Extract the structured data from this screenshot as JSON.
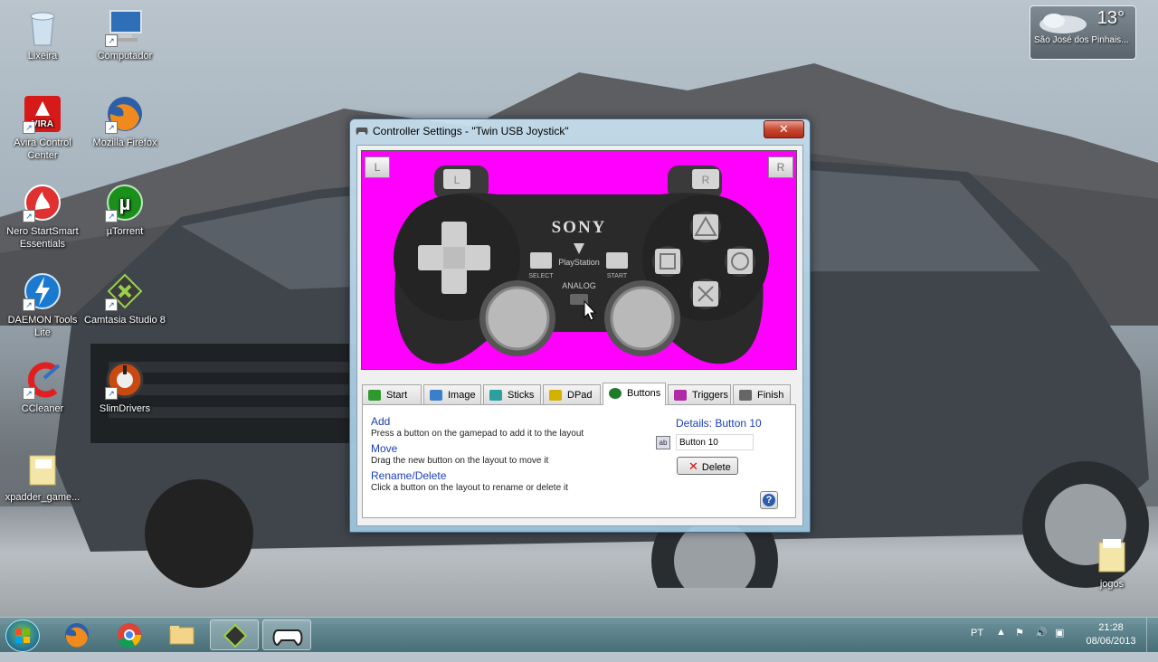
{
  "desktop": {
    "icons": [
      {
        "label": "Lixeira",
        "icon": "recycle-bin-icon"
      },
      {
        "label": "Computador",
        "icon": "computer-icon"
      },
      {
        "label": "Avira Control Center",
        "icon": "avira-icon"
      },
      {
        "label": "Mozilla Firefox",
        "icon": "firefox-icon"
      },
      {
        "label": "Nero StartSmart Essentials",
        "icon": "nero-icon"
      },
      {
        "label": "µTorrent",
        "icon": "utorrent-icon"
      },
      {
        "label": "DAEMON Tools Lite",
        "icon": "daemon-tools-icon"
      },
      {
        "label": "Camtasia Studio 8",
        "icon": "camtasia-icon"
      },
      {
        "label": "CCleaner",
        "icon": "ccleaner-icon"
      },
      {
        "label": "SlimDrivers",
        "icon": "slimdrivers-icon"
      },
      {
        "label": "xpadder_game...",
        "icon": "folder-icon"
      },
      {
        "label": "jogos",
        "icon": "folder-icon"
      }
    ],
    "avira_badge": "VIRA"
  },
  "weather": {
    "temp": "13°",
    "city": "São José dos Pinhais..."
  },
  "window": {
    "title": "Controller Settings - \"Twin USB Joystick\"",
    "close_glyph": "✕",
    "gamepad": {
      "brand": "SONY",
      "logo_text": "PlayStation",
      "select_label": "SELECT",
      "start_label": "START",
      "analog_label": "ANALOG",
      "l_label": "L",
      "r_label": "R"
    },
    "tabs": [
      {
        "label": "Start",
        "color": "#2e9a2e"
      },
      {
        "label": "Image",
        "color": "#3a7fc9"
      },
      {
        "label": "Sticks",
        "color": "#2aa0a0"
      },
      {
        "label": "DPad",
        "color": "#d4b000"
      },
      {
        "label": "Buttons",
        "color": "#1f7a2a",
        "active": true
      },
      {
        "label": "Triggers",
        "color": "#b02aa8"
      },
      {
        "label": "Finish",
        "color": "#666666"
      }
    ],
    "panel": {
      "add_link": "Add",
      "add_desc": "Press a button on the gamepad to add it to the layout",
      "move_link": "Move",
      "move_desc": "Drag the new button on the layout to move it",
      "rename_link": "Rename/Delete",
      "rename_desc": "Click a button on the layout to rename or delete it",
      "details_label": "Details: Button 10",
      "name_value": "Button 10",
      "delete_label": "Delete",
      "help_glyph": "?"
    }
  },
  "taskbar": {
    "language": "PT",
    "time": "21:28",
    "date": "08/06/2013",
    "pinned": [
      "windows-start-orb",
      "firefox-icon",
      "chrome-icon",
      "explorer-icon",
      "camtasia-icon",
      "xpadder-icon"
    ]
  }
}
